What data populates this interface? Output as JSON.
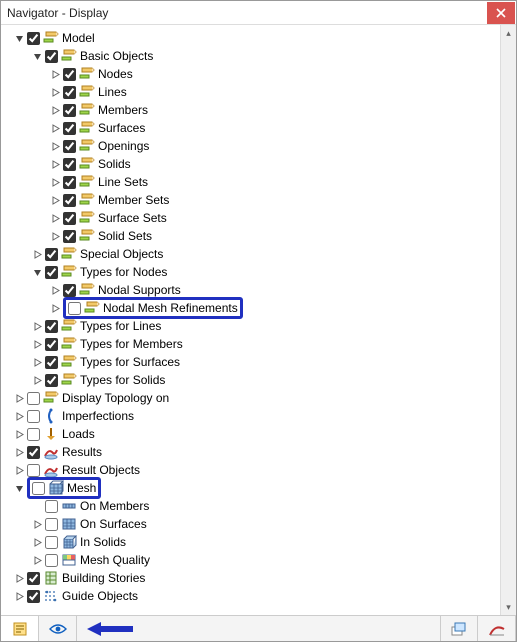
{
  "window": {
    "title": "Navigator - Display"
  },
  "tree": [
    {
      "depth": 0,
      "toggle": "open",
      "checked": true,
      "icon": "pencil",
      "key": "model",
      "label": "Model"
    },
    {
      "depth": 1,
      "toggle": "open",
      "checked": true,
      "icon": "pencil",
      "key": "basic_objects",
      "label": "Basic Objects"
    },
    {
      "depth": 2,
      "toggle": "closed",
      "checked": true,
      "icon": "pencil",
      "key": "nodes",
      "label": "Nodes"
    },
    {
      "depth": 2,
      "toggle": "closed",
      "checked": true,
      "icon": "pencil",
      "key": "lines",
      "label": "Lines"
    },
    {
      "depth": 2,
      "toggle": "closed",
      "checked": true,
      "icon": "pencil",
      "key": "members",
      "label": "Members"
    },
    {
      "depth": 2,
      "toggle": "closed",
      "checked": true,
      "icon": "pencil",
      "key": "surfaces",
      "label": "Surfaces"
    },
    {
      "depth": 2,
      "toggle": "closed",
      "checked": true,
      "icon": "pencil",
      "key": "openings",
      "label": "Openings"
    },
    {
      "depth": 2,
      "toggle": "closed",
      "checked": true,
      "icon": "pencil",
      "key": "solids",
      "label": "Solids"
    },
    {
      "depth": 2,
      "toggle": "closed",
      "checked": true,
      "icon": "pencil",
      "key": "line_sets",
      "label": "Line Sets"
    },
    {
      "depth": 2,
      "toggle": "closed",
      "checked": true,
      "icon": "pencil",
      "key": "member_sets",
      "label": "Member Sets"
    },
    {
      "depth": 2,
      "toggle": "closed",
      "checked": true,
      "icon": "pencil",
      "key": "surface_sets",
      "label": "Surface Sets"
    },
    {
      "depth": 2,
      "toggle": "closed",
      "checked": true,
      "icon": "pencil",
      "key": "solid_sets",
      "label": "Solid Sets"
    },
    {
      "depth": 1,
      "toggle": "closed",
      "checked": true,
      "icon": "pencil",
      "key": "special_objects",
      "label": "Special Objects"
    },
    {
      "depth": 1,
      "toggle": "open",
      "checked": true,
      "icon": "pencil",
      "key": "types_for_nodes",
      "label": "Types for Nodes"
    },
    {
      "depth": 2,
      "toggle": "closed",
      "checked": true,
      "icon": "pencil",
      "key": "nodal_supports",
      "label": "Nodal Supports"
    },
    {
      "depth": 2,
      "toggle": "closed",
      "checked": false,
      "icon": "pencil",
      "key": "nodal_mesh_refinements",
      "label": "Nodal Mesh Refinements",
      "highlight": true
    },
    {
      "depth": 1,
      "toggle": "closed",
      "checked": true,
      "icon": "pencil",
      "key": "types_for_lines",
      "label": "Types for Lines"
    },
    {
      "depth": 1,
      "toggle": "closed",
      "checked": true,
      "icon": "pencil",
      "key": "types_for_members",
      "label": "Types for Members"
    },
    {
      "depth": 1,
      "toggle": "closed",
      "checked": true,
      "icon": "pencil",
      "key": "types_for_surfaces",
      "label": "Types for Surfaces"
    },
    {
      "depth": 1,
      "toggle": "closed",
      "checked": true,
      "icon": "pencil",
      "key": "types_for_solids",
      "label": "Types for Solids"
    },
    {
      "depth": 0,
      "toggle": "closed",
      "checked": false,
      "icon": "pencil",
      "key": "display_topology_on",
      "label": "Display Topology on"
    },
    {
      "depth": 0,
      "toggle": "closed",
      "checked": false,
      "icon": "imperfection",
      "key": "imperfections",
      "label": "Imperfections"
    },
    {
      "depth": 0,
      "toggle": "closed",
      "checked": false,
      "icon": "loads",
      "key": "loads",
      "label": "Loads"
    },
    {
      "depth": 0,
      "toggle": "closed",
      "checked": true,
      "icon": "results",
      "key": "results",
      "label": "Results"
    },
    {
      "depth": 0,
      "toggle": "closed",
      "checked": false,
      "icon": "results",
      "key": "result_objects",
      "label": "Result Objects"
    },
    {
      "depth": 0,
      "toggle": "open",
      "checked": false,
      "icon": "mesh",
      "key": "mesh",
      "label": "Mesh",
      "highlight": true
    },
    {
      "depth": 1,
      "toggle": "none",
      "checked": false,
      "icon": "mesh-members",
      "key": "mesh_on_members",
      "label": "On Members"
    },
    {
      "depth": 1,
      "toggle": "closed",
      "checked": false,
      "icon": "mesh-surfaces",
      "key": "mesh_on_surfaces",
      "label": "On Surfaces"
    },
    {
      "depth": 1,
      "toggle": "closed",
      "checked": false,
      "icon": "mesh-solids",
      "key": "mesh_in_solids",
      "label": "In Solids"
    },
    {
      "depth": 1,
      "toggle": "closed",
      "checked": false,
      "icon": "mesh-quality",
      "key": "mesh_quality",
      "label": "Mesh Quality"
    },
    {
      "depth": 0,
      "toggle": "closed",
      "checked": true,
      "icon": "building",
      "key": "building_stories",
      "label": "Building Stories"
    },
    {
      "depth": 0,
      "toggle": "closed",
      "checked": true,
      "icon": "guide",
      "key": "guide_objects",
      "label": "Guide Objects"
    }
  ],
  "tabs": {
    "data_tab": "data",
    "display_tab": "display",
    "views_tab": "views",
    "results_tab": "results"
  }
}
